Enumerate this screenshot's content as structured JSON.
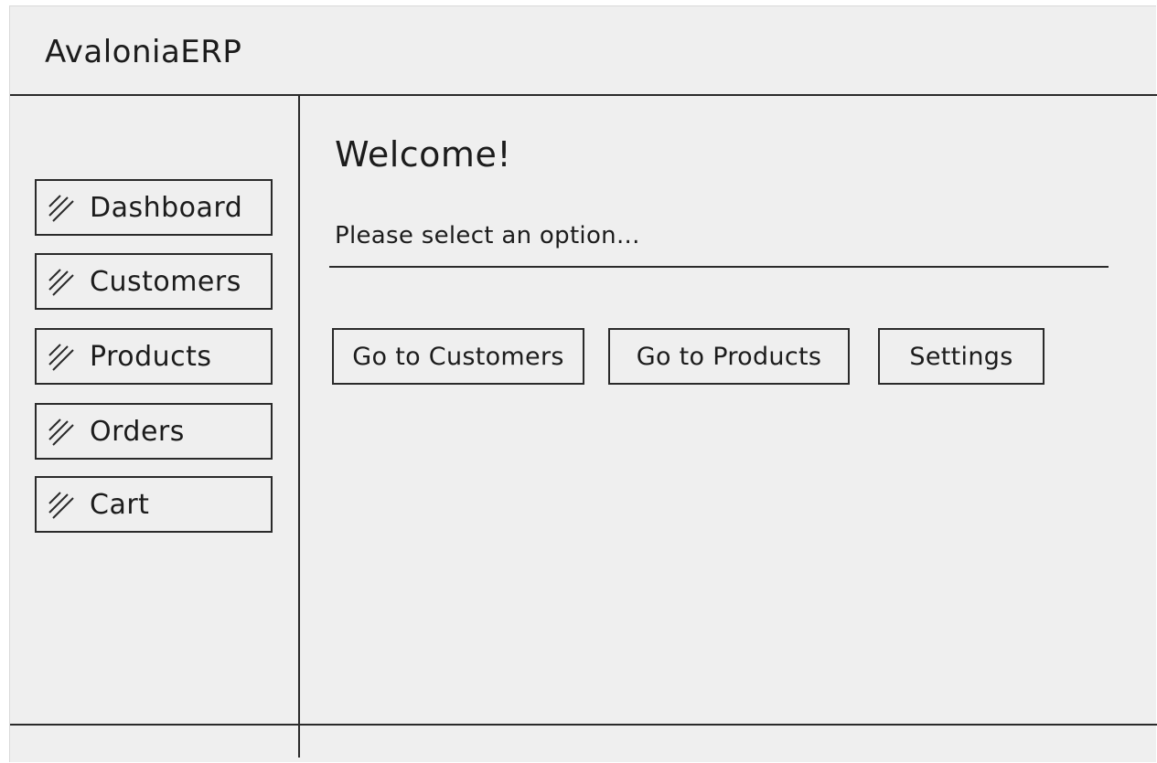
{
  "app": {
    "title": "AvaloniaERP"
  },
  "sidebar": {
    "items": [
      {
        "label": "Dashboard"
      },
      {
        "label": "Customers"
      },
      {
        "label": "Products"
      },
      {
        "label": "Orders"
      },
      {
        "label": "Cart"
      }
    ]
  },
  "main": {
    "heading": "Welcome!",
    "prompt": "Please select an option...",
    "actions": [
      {
        "label": "Go to Customers"
      },
      {
        "label": "Go to Products"
      },
      {
        "label": "Settings"
      }
    ]
  },
  "icons": {
    "nav": "hatch-icon"
  },
  "colors": {
    "background": "#efefef",
    "ink": "#2a2a2a"
  }
}
